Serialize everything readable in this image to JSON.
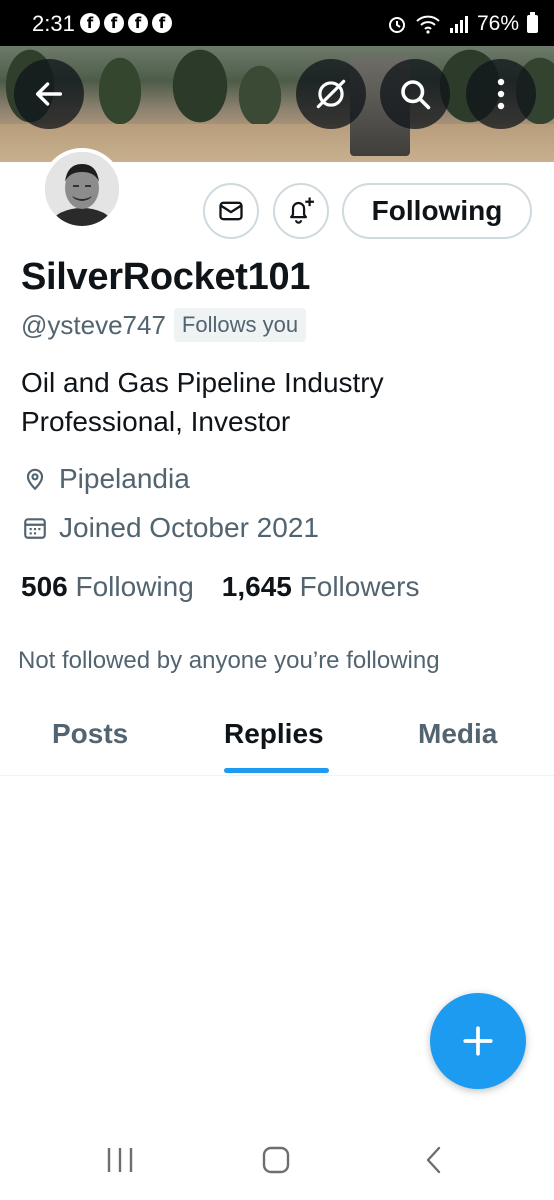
{
  "status_bar": {
    "time": "2:31",
    "notification_icons": [
      "f",
      "f",
      "f",
      "f"
    ],
    "battery": "76%"
  },
  "profile": {
    "display_name": "SilverRocket101",
    "handle": "@ysteve747",
    "follows_you_label": "Follows you",
    "bio": "Oil and Gas Pipeline Industry Professional, Investor",
    "location": "Pipelandia",
    "joined": "Joined October 2021",
    "following_count": "506",
    "following_label": "Following",
    "followers_count": "1,645",
    "followers_label": "Followers",
    "mutuals_note": "Not followed by anyone you’re following"
  },
  "actions": {
    "following_button_label": "Following"
  },
  "tabs": [
    {
      "label": "Posts",
      "active": false
    },
    {
      "label": "Replies",
      "active": true
    },
    {
      "label": "Media",
      "active": false
    }
  ],
  "colors": {
    "accent": "#1d9bf0",
    "text_primary": "#0f1419",
    "text_secondary": "#536471",
    "border": "#cfd9de"
  },
  "icons": {
    "back": "arrow-left-icon",
    "translate": "globe-strike-icon",
    "search": "search-icon",
    "more": "more-vertical-icon",
    "message": "envelope-icon",
    "notify": "bell-plus-icon",
    "location": "location-pin-icon",
    "calendar": "calendar-icon",
    "compose": "plus-icon"
  }
}
